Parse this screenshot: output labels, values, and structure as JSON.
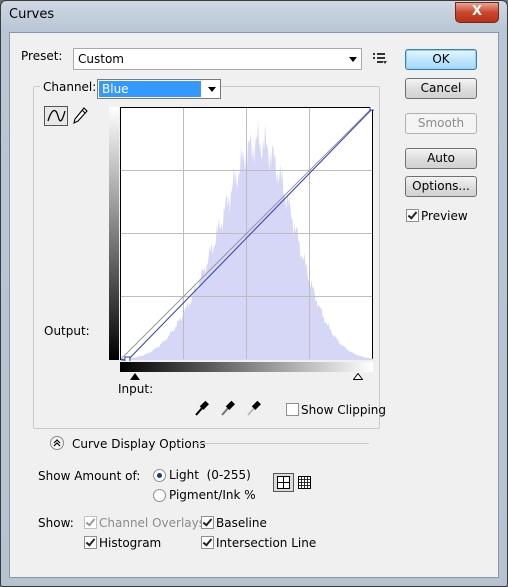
{
  "window": {
    "title": "Curves",
    "close_glyph": "X"
  },
  "preset": {
    "label": "Preset:",
    "value": "Custom",
    "menu_icon": "preset-options-icon"
  },
  "buttons": {
    "ok": "OK",
    "cancel": "Cancel",
    "smooth": "Smooth",
    "auto": "Auto",
    "options": "Options..."
  },
  "preview": {
    "label": "Preview",
    "checked": true
  },
  "channel": {
    "label": "Channel:",
    "value": "Blue"
  },
  "graph": {
    "output_label": "Output:",
    "input_label": "Input:",
    "curve_color": "#2a3cc0",
    "histogram_color": "#d6d6f6",
    "curve_points": [
      [
        7,
        0
      ],
      [
        255,
        255
      ]
    ],
    "input_black": 7,
    "input_white": 255
  },
  "eyedroppers": [
    "black-point-eyedropper-icon",
    "gray-point-eyedropper-icon",
    "white-point-eyedropper-icon"
  ],
  "show_clipping": {
    "label": "Show Clipping",
    "checked": false
  },
  "display_options": {
    "title": "Curve Display Options"
  },
  "show_amount": {
    "label": "Show Amount of:",
    "light": "Light  (0-255)",
    "pigment": "Pigment/Ink %",
    "selected": "light"
  },
  "show": {
    "label": "Show:",
    "channel_overlays": {
      "label": "Channel Overlays",
      "checked": true,
      "disabled": true
    },
    "baseline": {
      "label": "Baseline",
      "checked": true
    },
    "histogram": {
      "label": "Histogram",
      "checked": true
    },
    "intersection": {
      "label": "Intersection Line",
      "checked": true
    }
  }
}
